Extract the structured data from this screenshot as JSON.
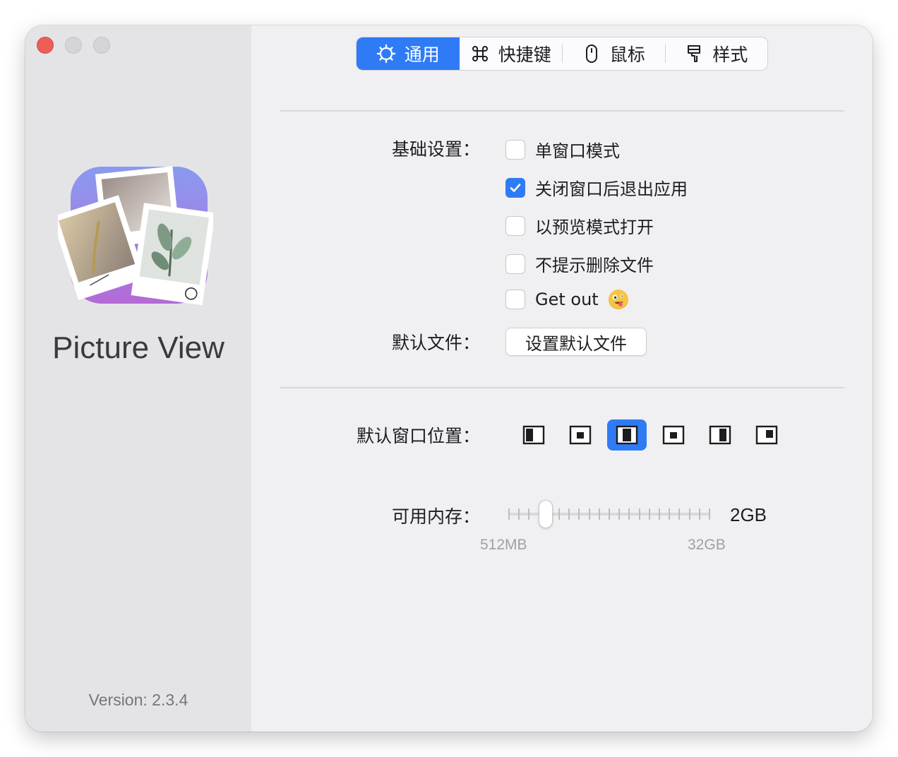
{
  "sidebar": {
    "app_name": "Picture View",
    "version": "Version: 2.3.4"
  },
  "tabs": [
    {
      "label": "通用",
      "icon": "gear-icon",
      "active": true
    },
    {
      "label": "快捷键",
      "icon": "command-icon",
      "active": false
    },
    {
      "label": "鼠标",
      "icon": "mouse-icon",
      "active": false
    },
    {
      "label": "样式",
      "icon": "paintbrush-icon",
      "active": false
    }
  ],
  "basic": {
    "label": "基础设置：",
    "options": [
      {
        "label": "单窗口模式",
        "checked": false
      },
      {
        "label": "关闭窗口后退出应用",
        "checked": true
      },
      {
        "label": "以预览模式打开",
        "checked": false
      },
      {
        "label": "不提示删除文件",
        "checked": false
      },
      {
        "label": "Get out",
        "checked": false,
        "emoji": "zany-face-icon"
      }
    ]
  },
  "default_file": {
    "label": "默认文件：",
    "button": "设置默认文件"
  },
  "window_position": {
    "label": "默认窗口位置：",
    "options": [
      "left",
      "center-small",
      "center",
      "center-small-alt",
      "right",
      "top-right"
    ],
    "selected_index": 2
  },
  "memory": {
    "label": "可用内存：",
    "value": "2GB",
    "min_label": "512MB",
    "max_label": "32GB",
    "slider_fraction": 0.16
  },
  "colors": {
    "accent": "#2f7bf5",
    "close": "#ee5e56"
  }
}
